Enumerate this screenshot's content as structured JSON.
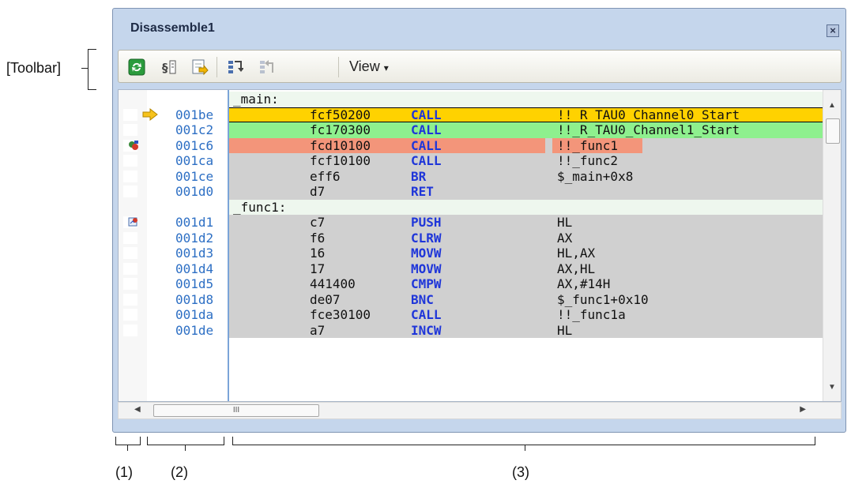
{
  "annotations": {
    "toolbar_label": "[Toolbar]",
    "area1": "(1)",
    "area2": "(2)",
    "area3": "(3)"
  },
  "window": {
    "title": "Disassemble1",
    "close_glyph": "×"
  },
  "toolbar": {
    "view_label": "View",
    "view_arrow": "▾",
    "icons": [
      "refresh-icon",
      "go-to-symbol-icon",
      "go-to-program-counter-icon",
      "step-in-icon",
      "step-out-icon"
    ]
  },
  "rows": [
    {
      "type": "label",
      "text": "_main:"
    },
    {
      "type": "code",
      "addr": "001be",
      "code": "fcf50200",
      "mnem": "CALL",
      "opnd": "!!_R_TAU0_Channel0_Start",
      "icon": "pc-arrow-icon",
      "highlight": "yellow"
    },
    {
      "type": "code",
      "addr": "001c2",
      "code": "fc170300",
      "mnem": "CALL",
      "opnd": "!!_R_TAU0_Channel1_Start",
      "icon": "",
      "highlight": "green"
    },
    {
      "type": "code",
      "addr": "001c6",
      "code": "fcd10100",
      "mnem": "CALL",
      "opnd": "!!_func1",
      "icon": "breakpoint-event-icon",
      "highlight": "red"
    },
    {
      "type": "code",
      "addr": "001ca",
      "code": "fcf10100",
      "mnem": "CALL",
      "opnd": "!!_func2",
      "icon": "",
      "highlight": ""
    },
    {
      "type": "code",
      "addr": "001ce",
      "code": "eff6",
      "mnem": "BR",
      "opnd": "$_main+0x8",
      "icon": "",
      "highlight": ""
    },
    {
      "type": "code",
      "addr": "001d0",
      "code": "d7",
      "mnem": "RET",
      "opnd": "",
      "icon": "",
      "highlight": ""
    },
    {
      "type": "label",
      "text": "_func1:"
    },
    {
      "type": "code",
      "addr": "001d1",
      "code": "c7",
      "mnem": "PUSH",
      "opnd": "HL",
      "icon": "event-icon",
      "highlight": ""
    },
    {
      "type": "code",
      "addr": "001d2",
      "code": "f6",
      "mnem": "CLRW",
      "opnd": "AX",
      "icon": "",
      "highlight": ""
    },
    {
      "type": "code",
      "addr": "001d3",
      "code": "16",
      "mnem": "MOVW",
      "opnd": "HL,AX",
      "icon": "",
      "highlight": ""
    },
    {
      "type": "code",
      "addr": "001d4",
      "code": "17",
      "mnem": "MOVW",
      "opnd": "AX,HL",
      "icon": "",
      "highlight": ""
    },
    {
      "type": "code",
      "addr": "001d5",
      "code": "441400",
      "mnem": "CMPW",
      "opnd": "AX,#14H",
      "icon": "",
      "highlight": ""
    },
    {
      "type": "code",
      "addr": "001d8",
      "code": "de07",
      "mnem": "BNC",
      "opnd": "$_func1+0x10",
      "icon": "",
      "highlight": ""
    },
    {
      "type": "code",
      "addr": "001da",
      "code": "fce30100",
      "mnem": "CALL",
      "opnd": "!!_func1a",
      "icon": "",
      "highlight": ""
    },
    {
      "type": "code",
      "addr": "001de",
      "code": "a7",
      "mnem": "INCW",
      "opnd": "HL",
      "icon": "",
      "highlight": ""
    }
  ],
  "scroll": {
    "h_thumb_grip": "III"
  }
}
